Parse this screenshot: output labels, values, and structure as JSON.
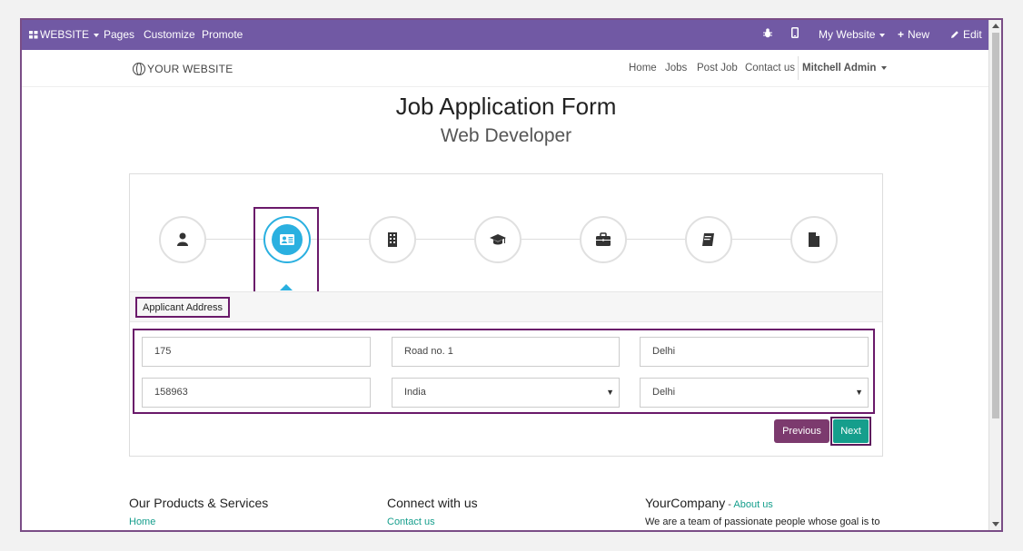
{
  "topbar": {
    "app_menu": "WEBSITE",
    "pages": "Pages",
    "customize": "Customize",
    "promote": "Promote",
    "website_select": "My Website",
    "new": "New",
    "edit": "Edit",
    "bar_color": "#7159a4"
  },
  "header": {
    "logo": "YOUR WEBSITE",
    "nav": [
      "Home",
      "Jobs",
      "Post Job",
      "Contact us"
    ],
    "user": "Mitchell Admin"
  },
  "page": {
    "title": "Job Application Form",
    "subtitle": "Web Developer"
  },
  "steps": {
    "icons": [
      "user-icon",
      "address-card-icon",
      "building-icon",
      "graduation-cap-icon",
      "briefcase-icon",
      "book-icon",
      "document-icon"
    ],
    "active_index": 1,
    "active_color": "#2ab0e0"
  },
  "section": {
    "label": "Applicant Address"
  },
  "form": {
    "house_no": "175",
    "street": "Road no. 1",
    "city": "Delhi",
    "zip": "158963",
    "country": "India",
    "state": "Delhi"
  },
  "buttons": {
    "previous": "Previous",
    "next": "Next",
    "previous_color": "#7c3a6e",
    "next_color": "#159e8c"
  },
  "footer": {
    "col1_title": "Our Products & Services",
    "col1_link": "Home",
    "col2_title": "Connect with us",
    "col2_link": "Contact us",
    "col3_title": "YourCompany",
    "col3_sep": " - ",
    "col3_about": "About us",
    "col3_text": "We are a team of passionate people whose goal is to"
  }
}
